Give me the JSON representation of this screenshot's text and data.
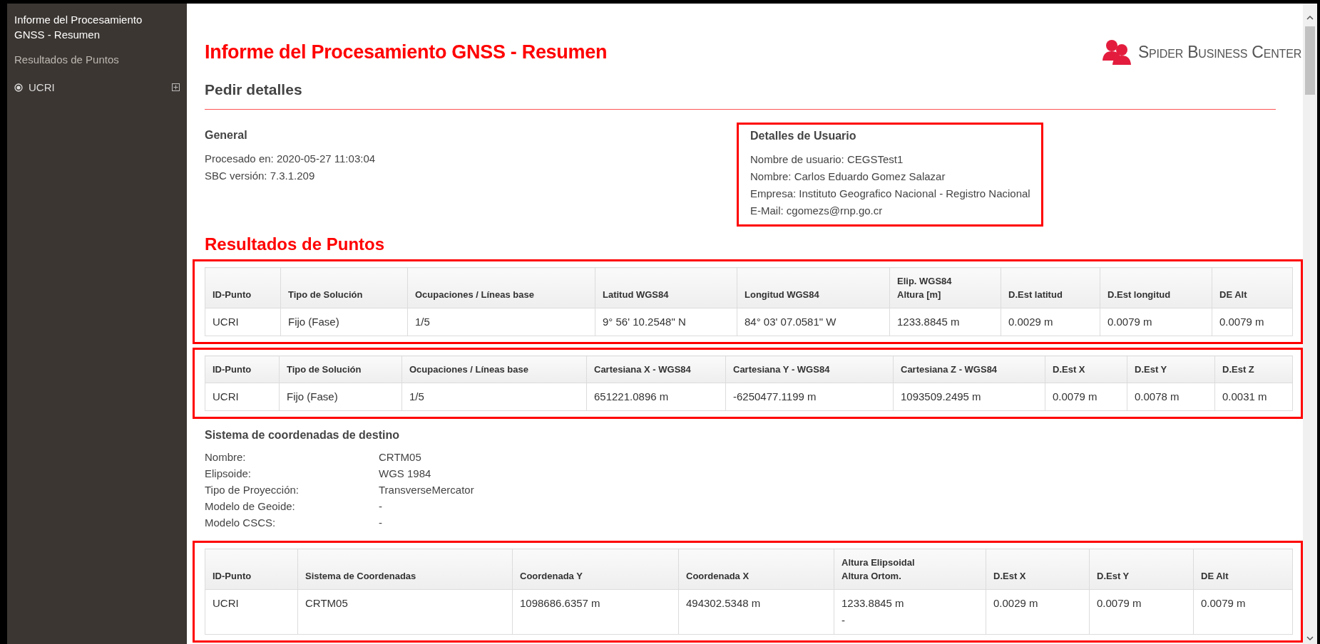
{
  "sidebar": {
    "title": "Informe del Procesamiento GNSS - Resumen",
    "section": "Resultados de Puntos",
    "items": [
      {
        "label": "UCRI",
        "selected": true,
        "expanded": false
      }
    ]
  },
  "report": {
    "title": "Informe del Procesamiento GNSS - Resumen",
    "logo_text": "Spider Business Center",
    "order_heading": "Pedir detalles",
    "general": {
      "heading": "General",
      "lines": [
        "Procesado en: 2020-05-27 11:03:04",
        "SBC versión: 7.3.1.209"
      ]
    },
    "user_details": {
      "heading": "Detalles de Usuario",
      "highlighted": true,
      "lines": [
        "Nombre de usuario: CEGSTest1",
        "Nombre: Carlos Eduardo Gomez Salazar",
        "Empresa: Instituto Geografico Nacional - Registro Nacional",
        "E-Mail: cgomezs@rnp.go.cr"
      ]
    },
    "results_heading": "Resultados de Puntos",
    "wgs84_tables": [
      {
        "highlighted": true,
        "columns": [
          "ID-Punto",
          "Tipo de Solución",
          "Ocupaciones / Líneas base",
          "Latitud WGS84",
          "Longitud WGS84",
          "Elip. WGS84\nAltura [m]",
          "D.Est latitud",
          "D.Est longitud",
          "DE Alt"
        ],
        "rows": [
          [
            "UCRI",
            "Fijo (Fase)",
            "1/5",
            "9° 56' 10.2548\" N",
            "84° 03' 07.0581\" W",
            "1233.8845 m",
            "0.0029 m",
            "0.0079 m",
            "0.0079 m"
          ]
        ]
      },
      {
        "highlighted": true,
        "columns": [
          "ID-Punto",
          "Tipo de Solución",
          "Ocupaciones / Líneas base",
          "Cartesiana X - WGS84",
          "Cartesiana Y - WGS84",
          "Cartesiana Z - WGS84",
          "D.Est X",
          "D.Est Y",
          "D.Est Z"
        ],
        "rows": [
          [
            "UCRI",
            "Fijo (Fase)",
            "1/5",
            "651221.0896 m",
            "-6250477.1199 m",
            "1093509.2495 m",
            "0.0079 m",
            "0.0078 m",
            "0.0031 m"
          ]
        ]
      }
    ],
    "target_system": {
      "heading": "Sistema de coordenadas de destino",
      "fields": [
        {
          "label": "Nombre:",
          "value": "CRTM05"
        },
        {
          "label": "Elipsoide:",
          "value": "WGS 1984"
        },
        {
          "label": "Tipo de Proyección:",
          "value": "TransverseMercator"
        },
        {
          "label": "Modelo de Geoide:",
          "value": "-"
        },
        {
          "label": "Modelo CSCS:",
          "value": "-"
        }
      ]
    },
    "projected_table": {
      "highlighted": true,
      "columns": [
        "ID-Punto",
        "Sistema de Coordenadas",
        "Coordenada Y",
        "Coordenada X",
        "Altura Elipsoidal\nAltura Ortom.",
        "D.Est X",
        "D.Est Y",
        "DE Alt"
      ],
      "rows": [
        [
          "UCRI",
          "CRTM05",
          "1098686.6357 m",
          "494302.5348 m",
          "1233.8845 m\n-",
          "0.0029 m",
          "0.0079 m",
          "0.0079 m"
        ]
      ]
    }
  }
}
